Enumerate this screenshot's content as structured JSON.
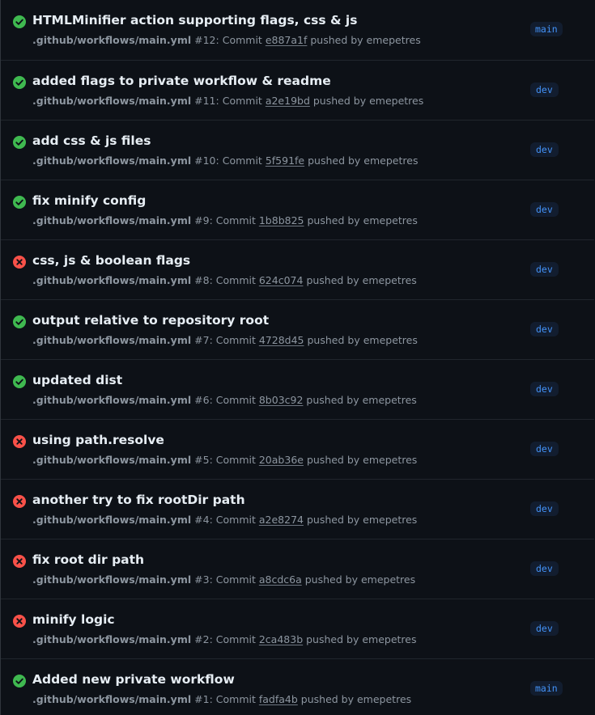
{
  "runs": [
    {
      "status": "success",
      "status_icon": "check-circle-icon",
      "title": "HTMLMinifier action supporting flags, css & js",
      "workflow": ".github/workflows/main.yml",
      "run_number": "#12",
      "commit_label": "Commit",
      "sha": "e887a1f",
      "pushed_by": "pushed by emepetres",
      "branch": "main"
    },
    {
      "status": "success",
      "status_icon": "check-circle-icon",
      "title": "added flags to private workflow & readme",
      "workflow": ".github/workflows/main.yml",
      "run_number": "#11",
      "commit_label": "Commit",
      "sha": "a2e19bd",
      "pushed_by": "pushed by emepetres",
      "branch": "dev"
    },
    {
      "status": "success",
      "status_icon": "check-circle-icon",
      "title": "add css & js files",
      "workflow": ".github/workflows/main.yml",
      "run_number": "#10",
      "commit_label": "Commit",
      "sha": "5f591fe",
      "pushed_by": "pushed by emepetres",
      "branch": "dev"
    },
    {
      "status": "success",
      "status_icon": "check-circle-icon",
      "title": "fix minify config",
      "workflow": ".github/workflows/main.yml",
      "run_number": "#9",
      "commit_label": "Commit",
      "sha": "1b8b825",
      "pushed_by": "pushed by emepetres",
      "branch": "dev"
    },
    {
      "status": "failure",
      "status_icon": "x-circle-icon",
      "title": "css, js & boolean flags",
      "workflow": ".github/workflows/main.yml",
      "run_number": "#8",
      "commit_label": "Commit",
      "sha": "624c074",
      "pushed_by": "pushed by emepetres",
      "branch": "dev"
    },
    {
      "status": "success",
      "status_icon": "check-circle-icon",
      "title": "output relative to repository root",
      "workflow": ".github/workflows/main.yml",
      "run_number": "#7",
      "commit_label": "Commit",
      "sha": "4728d45",
      "pushed_by": "pushed by emepetres",
      "branch": "dev"
    },
    {
      "status": "success",
      "status_icon": "check-circle-icon",
      "title": "updated dist",
      "workflow": ".github/workflows/main.yml",
      "run_number": "#6",
      "commit_label": "Commit",
      "sha": "8b03c92",
      "pushed_by": "pushed by emepetres",
      "branch": "dev"
    },
    {
      "status": "failure",
      "status_icon": "x-circle-icon",
      "title": "using path.resolve",
      "workflow": ".github/workflows/main.yml",
      "run_number": "#5",
      "commit_label": "Commit",
      "sha": "20ab36e",
      "pushed_by": "pushed by emepetres",
      "branch": "dev"
    },
    {
      "status": "failure",
      "status_icon": "x-circle-icon",
      "title": "another try to fix rootDir path",
      "workflow": ".github/workflows/main.yml",
      "run_number": "#4",
      "commit_label": "Commit",
      "sha": "a2e8274",
      "pushed_by": "pushed by emepetres",
      "branch": "dev"
    },
    {
      "status": "failure",
      "status_icon": "x-circle-icon",
      "title": "fix root dir path",
      "workflow": ".github/workflows/main.yml",
      "run_number": "#3",
      "commit_label": "Commit",
      "sha": "a8cdc6a",
      "pushed_by": "pushed by emepetres",
      "branch": "dev"
    },
    {
      "status": "failure",
      "status_icon": "x-circle-icon",
      "title": "minify logic",
      "workflow": ".github/workflows/main.yml",
      "run_number": "#2",
      "commit_label": "Commit",
      "sha": "2ca483b",
      "pushed_by": "pushed by emepetres",
      "branch": "dev"
    },
    {
      "status": "success",
      "status_icon": "check-circle-icon",
      "title": "Added new private workflow",
      "workflow": ".github/workflows/main.yml",
      "run_number": "#1",
      "commit_label": "Commit",
      "sha": "fadfa4b",
      "pushed_by": "pushed by emepetres",
      "branch": "main"
    }
  ],
  "colors": {
    "success": "#3fb950",
    "failure": "#f85149",
    "background": "#0d1117",
    "branch_text": "#4493f8",
    "branch_bg": "#121d2f"
  }
}
